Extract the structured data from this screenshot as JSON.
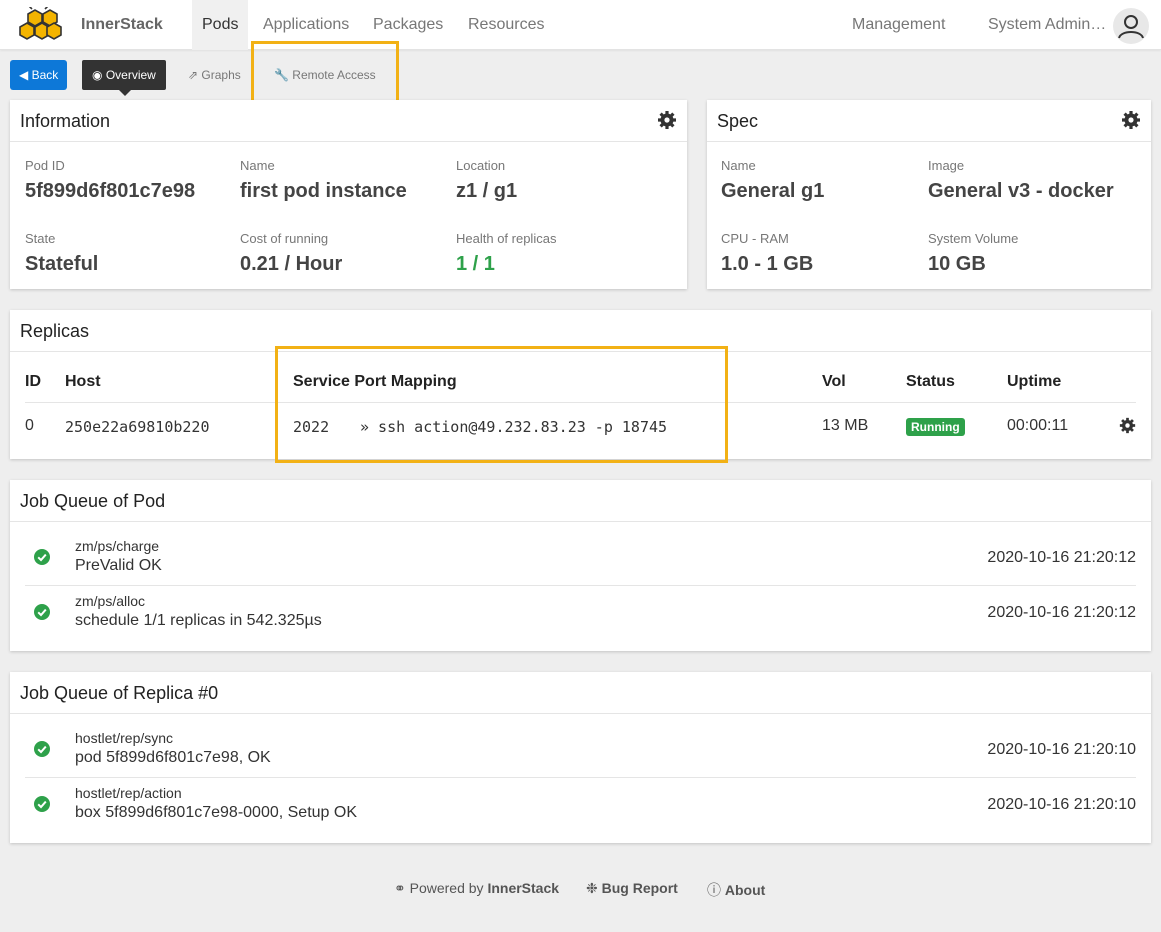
{
  "app": {
    "brand": "InnerStack",
    "logo_icon": "honeycomb-logo"
  },
  "nav": {
    "items": [
      "Pods",
      "Applications",
      "Packages",
      "Resources"
    ],
    "right": [
      "Management",
      "System Admin…"
    ],
    "active": "Pods"
  },
  "toolbar": {
    "back": "Back",
    "overview": "Overview",
    "graphs": "Graphs",
    "remote_access": "Remote Access"
  },
  "information": {
    "title": "Information",
    "fields": [
      {
        "label": "Pod ID",
        "value": "5f899d6f801c7e98"
      },
      {
        "label": "Name",
        "value": "first pod instance"
      },
      {
        "label": "Location",
        "value": "z1 / g1"
      },
      {
        "label": "State",
        "value": "Stateful"
      },
      {
        "label": "Cost of running",
        "value": "0.21 / Hour"
      },
      {
        "label": "Health of replicas",
        "value": "1 / 1"
      }
    ]
  },
  "spec": {
    "title": "Spec",
    "fields": [
      {
        "label": "Name",
        "value": "General g1"
      },
      {
        "label": "Image",
        "value": "General v3 - docker"
      },
      {
        "label": "CPU - RAM",
        "value": "1.0 - 1 GB"
      },
      {
        "label": "System Volume",
        "value": "10 GB"
      }
    ]
  },
  "replicas": {
    "title": "Replicas",
    "columns": [
      "ID",
      "Host",
      "Service Port Mapping",
      "Vol",
      "Status",
      "Uptime"
    ],
    "rows": [
      {
        "id": "0",
        "host": "250e22a69810b220",
        "port": "2022",
        "mapping": "» ssh action@49.232.83.23 -p 18745",
        "vol": "13 MB",
        "status": "Running",
        "uptime": "00:00:11"
      }
    ]
  },
  "pod_jobs": {
    "title": "Job Queue of Pod",
    "rows": [
      {
        "name": "zm/ps/charge",
        "message": "PreValid OK",
        "time": "2020-10-16 21:20:12"
      },
      {
        "name": "zm/ps/alloc",
        "message": "schedule 1/1 replicas in 542.325µs",
        "time": "2020-10-16 21:20:12"
      }
    ]
  },
  "replica_jobs": {
    "title": "Job Queue of Replica #0",
    "rows": [
      {
        "name": "hostlet/rep/sync",
        "message": "pod 5f899d6f801c7e98, OK",
        "time": "2020-10-16 21:20:10"
      },
      {
        "name": "hostlet/rep/action",
        "message": "box 5f899d6f801c7e98-0000, Setup OK",
        "time": "2020-10-16 21:20:10"
      }
    ]
  },
  "footer": {
    "powered_prefix": "Powered by",
    "powered_brand": "InnerStack",
    "bug_report": "Bug Report",
    "about": "About"
  },
  "colors": {
    "accent": "#0d78d8",
    "success": "#2ea14a",
    "highlight": "#f2b115",
    "dark": "#333333"
  }
}
